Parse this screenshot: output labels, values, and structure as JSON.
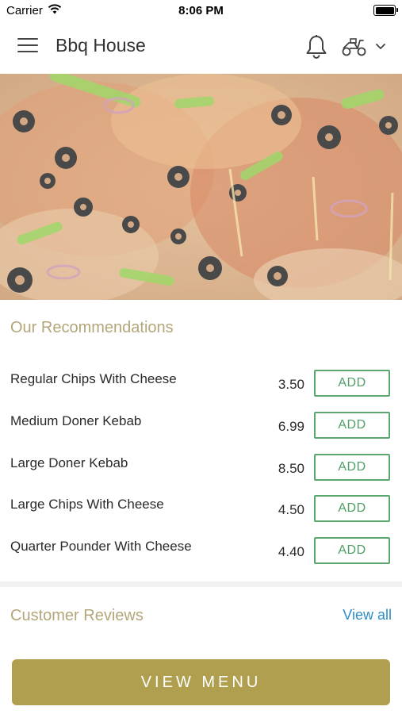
{
  "status_bar": {
    "carrier": "Carrier",
    "time": "8:06 PM"
  },
  "header": {
    "title": "Bbq House"
  },
  "hero": {
    "image": "pizza-photo"
  },
  "recommendations": {
    "title": "Our Recommendations",
    "items": [
      {
        "name": "Regular Chips With Cheese",
        "price": "3.50",
        "add_label": "ADD"
      },
      {
        "name": "Medium Doner Kebab",
        "price": "6.99",
        "add_label": "ADD"
      },
      {
        "name": "Large Doner Kebab",
        "price": "8.50",
        "add_label": "ADD"
      },
      {
        "name": "Large Chips With Cheese",
        "price": "4.50",
        "add_label": "ADD"
      },
      {
        "name": "Quarter Pounder With Cheese",
        "price": "4.40",
        "add_label": "ADD"
      }
    ]
  },
  "reviews": {
    "title": "Customer Reviews",
    "view_all_label": "View all"
  },
  "footer": {
    "view_menu_label": "VIEW MENU"
  },
  "colors": {
    "accent_gold": "#b09f4f",
    "section_title": "#b3a67a",
    "add_green": "#4f9f66",
    "link_blue": "#2f8fc8"
  },
  "icons": [
    "wifi-icon",
    "battery-icon",
    "hamburger-menu-icon",
    "bell-icon",
    "scooter-icon",
    "chevron-down-icon"
  ]
}
